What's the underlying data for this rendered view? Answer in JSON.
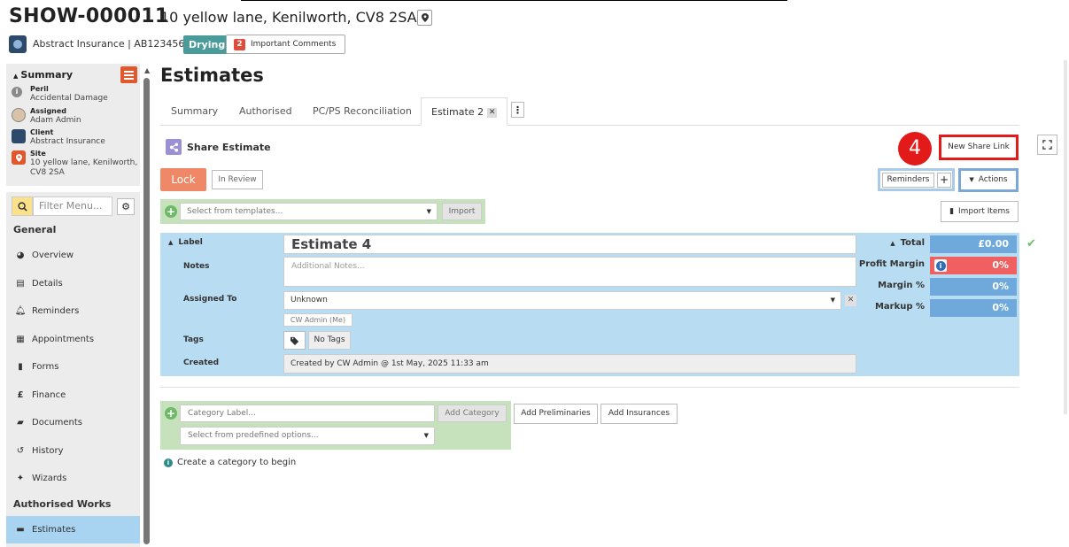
{
  "header": {
    "reference": "SHOW-000011",
    "address": "10 yellow lane, Kenilworth, CV8 2SA",
    "insurer": "Abstract Insurance | AB123456",
    "status": "Drying",
    "comments_count": "2",
    "comments_label": "Important Comments"
  },
  "summary": {
    "title": "Summary",
    "peril_label": "Peril",
    "peril_value": "Accidental Damage",
    "assigned_label": "Assigned",
    "assigned_value": "Adam Admin",
    "client_label": "Client",
    "client_value": "Abstract Insurance",
    "site_label": "Site",
    "site_value": "10 yellow lane, Kenilworth, CV8 2SA"
  },
  "menu": {
    "filter_placeholder": "Filter Menu...",
    "general_heading": "General",
    "items": [
      {
        "label": "Overview",
        "icon": "dashboard-icon"
      },
      {
        "label": "Details",
        "icon": "clipboard-icon"
      },
      {
        "label": "Reminders",
        "icon": "bell-icon"
      },
      {
        "label": "Appointments",
        "icon": "calendar-icon"
      },
      {
        "label": "Forms",
        "icon": "file-icon"
      },
      {
        "label": "Finance",
        "icon": "pound-icon"
      },
      {
        "label": "Documents",
        "icon": "folder-icon"
      },
      {
        "label": "History",
        "icon": "history-icon"
      },
      {
        "label": "Wizards",
        "icon": "wand-icon"
      }
    ],
    "works_heading": "Authorised Works",
    "active_item": "Estimates"
  },
  "main": {
    "title": "Estimates",
    "tabs": [
      "Summary",
      "Authorised",
      "PC/PS Reconciliation",
      "Estimate 2"
    ],
    "share_label": "Share Estimate",
    "step_number": "4",
    "new_share_link": "New Share Link",
    "lock": "Lock",
    "in_review": "In Review",
    "reminders": "Reminders",
    "plus": "+",
    "actions": "Actions",
    "template_placeholder": "Select from templates...",
    "import": "Import",
    "import_items": "Import Items"
  },
  "estimate": {
    "label_heading": "Label",
    "name": "Estimate 4",
    "notes_heading": "Notes",
    "notes_placeholder": "Additional Notes...",
    "assigned_heading": "Assigned To",
    "assigned_value": "Unknown",
    "assigned_chip": "CW Admin (Me)",
    "tags_heading": "Tags",
    "tags_value": "No Tags",
    "created_heading": "Created",
    "created_value": "Created by CW Admin @ 1st May, 2025 11:33 am",
    "total_label": "Total",
    "total_value": "£0.00",
    "profit_label": "Profit Margin",
    "profit_value": "0%",
    "margin_label": "Margin %",
    "margin_value": "0%",
    "markup_label": "Markup %",
    "markup_value": "0%"
  },
  "category": {
    "label_placeholder": "Category Label...",
    "add_category": "Add Category",
    "predefined_placeholder": "Select from predefined options...",
    "add_preliminaries": "Add Preliminaries",
    "add_insurances": "Add Insurances",
    "hint": "Create a category to begin"
  },
  "colors": {
    "accent_orange": "#e0582c",
    "lock": "#ee8866",
    "panel_blue": "#b8dcf2",
    "value_blue": "#6fa9dc",
    "alert_red": "#f06060",
    "template_green": "#c6e2bc",
    "step_red": "#e21a1a"
  }
}
